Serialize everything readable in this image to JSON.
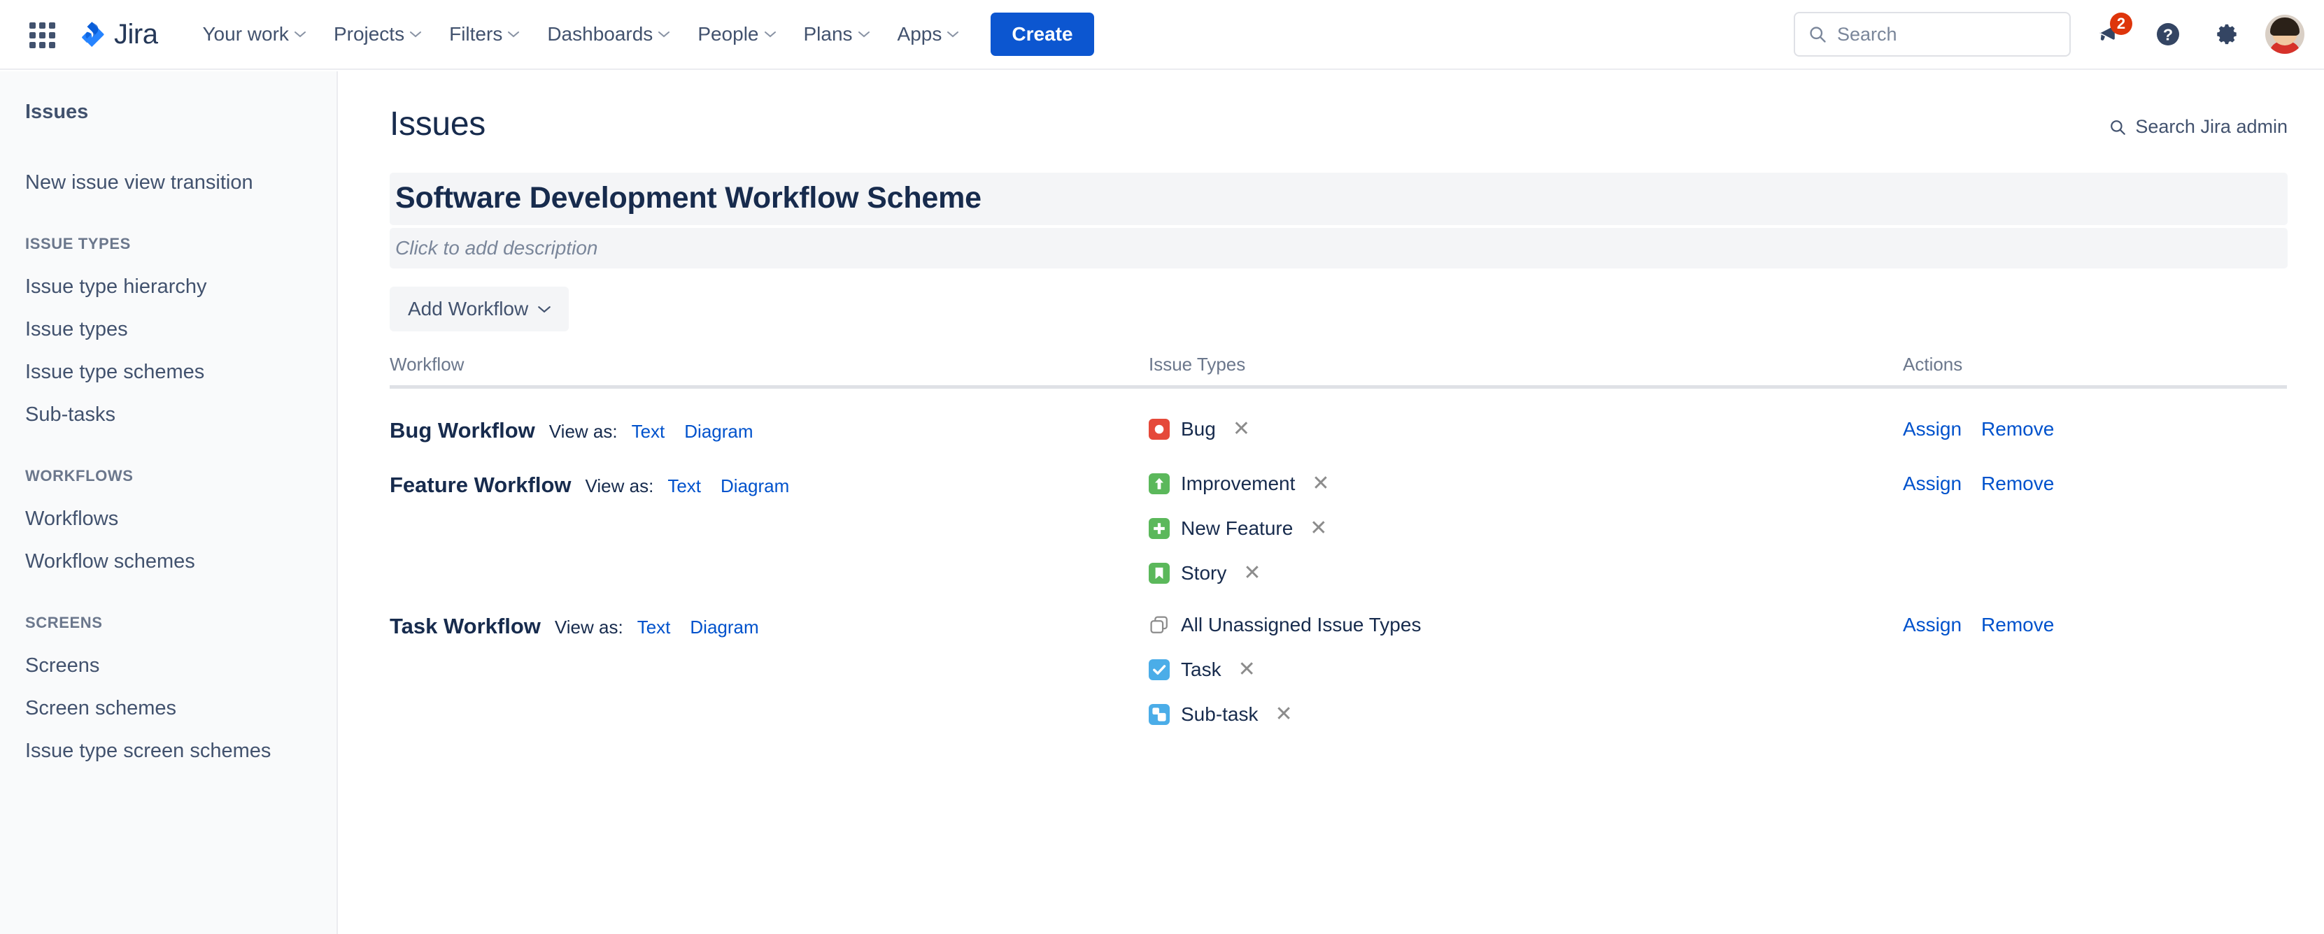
{
  "topnav": {
    "app_switcher": "app-switcher",
    "brand": "Jira",
    "links": [
      {
        "label": "Your work",
        "has_caret": true
      },
      {
        "label": "Projects",
        "has_caret": true
      },
      {
        "label": "Filters",
        "has_caret": true
      },
      {
        "label": "Dashboards",
        "has_caret": true
      },
      {
        "label": "People",
        "has_caret": true
      },
      {
        "label": "Plans",
        "has_caret": true
      },
      {
        "label": "Apps",
        "has_caret": true
      }
    ],
    "create_label": "Create",
    "search_placeholder": "Search",
    "notification_count": "2",
    "icons": {
      "search": "search-icon",
      "notifications": "megaphone-notification-icon",
      "help": "help-question-icon",
      "settings": "gear-settings-icon",
      "avatar": "user-avatar"
    }
  },
  "sidebar": {
    "title": "Issues",
    "top_items": [
      "New issue view transition"
    ],
    "groups": [
      {
        "heading": "ISSUE TYPES",
        "items": [
          "Issue type hierarchy",
          "Issue types",
          "Issue type schemes",
          "Sub-tasks"
        ]
      },
      {
        "heading": "WORKFLOWS",
        "items": [
          "Workflows",
          "Workflow schemes"
        ]
      },
      {
        "heading": "SCREENS",
        "items": [
          "Screens",
          "Screen schemes",
          "Issue type screen schemes"
        ]
      }
    ]
  },
  "main": {
    "page_title": "Issues",
    "admin_search_label": "Search Jira admin",
    "scheme_name": "Software Development Workflow Scheme",
    "scheme_description_placeholder": "Click to add description",
    "add_workflow_label": "Add Workflow",
    "table": {
      "headers": {
        "workflow": "Workflow",
        "issue_types": "Issue Types",
        "actions": "Actions"
      },
      "view_as_label": "View as:",
      "view_text_label": "Text",
      "view_diagram_label": "Diagram",
      "assign_label": "Assign",
      "remove_label": "Remove",
      "rows": [
        {
          "name": "Bug Workflow",
          "issue_types": [
            {
              "label": "Bug",
              "icon": "bug-icon",
              "color": "#e5493a",
              "removable": true
            }
          ]
        },
        {
          "name": "Feature Workflow",
          "issue_types": [
            {
              "label": "Improvement",
              "icon": "improvement-arrow-icon",
              "color": "#5bb85b",
              "removable": true
            },
            {
              "label": "New Feature",
              "icon": "new-feature-plus-icon",
              "color": "#5bb85b",
              "removable": true
            },
            {
              "label": "Story",
              "icon": "story-bookmark-icon",
              "color": "#5bb85b",
              "removable": true
            }
          ]
        },
        {
          "name": "Task Workflow",
          "issue_types": [
            {
              "label": "All Unassigned Issue Types",
              "icon": "all-unassigned-stack-icon",
              "color": "#8c8c8c",
              "removable": false
            },
            {
              "label": "Task",
              "icon": "task-check-icon",
              "color": "#4bade8",
              "removable": true
            },
            {
              "label": "Sub-task",
              "icon": "subtask-icon",
              "color": "#4bade8",
              "removable": true
            }
          ]
        }
      ]
    }
  },
  "colors": {
    "brand_blue": "#0052cc",
    "create_blue": "#0c56d0",
    "badge_red": "#de350b",
    "text_dark": "#172b4d",
    "text_muted": "#6b778c",
    "panel_gray": "#f4f5f7"
  }
}
